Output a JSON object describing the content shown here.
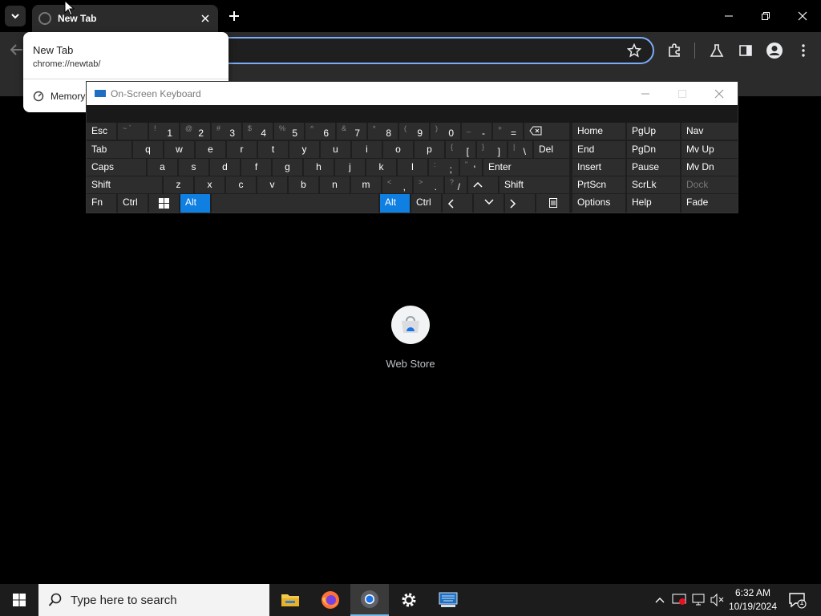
{
  "browser": {
    "tab_title": "New Tab",
    "hovercard": {
      "title": "New Tab",
      "url": "chrome://newtab/",
      "memory_label": "Memory"
    }
  },
  "osk": {
    "title": "On-Screen Keyboard",
    "rows": [
      [
        "Esc",
        "~ `",
        "! 1",
        "@ 2",
        "# 3",
        "$ 4",
        "% 5",
        "^ 6",
        "& 7",
        "* 8",
        "( 9",
        ") 0",
        "_ -",
        "+ =",
        "⌫",
        "Home",
        "PgUp",
        "Nav"
      ],
      [
        "Tab",
        "q",
        "w",
        "e",
        "r",
        "t",
        "y",
        "u",
        "i",
        "o",
        "p",
        "{ [",
        "} ]",
        "| \\",
        "Del",
        "End",
        "PgDn",
        "Mv Up"
      ],
      [
        "Caps",
        "a",
        "s",
        "d",
        "f",
        "g",
        "h",
        "j",
        "k",
        "l",
        ": ;",
        "\" '",
        "Enter",
        "Insert",
        "Pause",
        "Mv Dn"
      ],
      [
        "Shift",
        "z",
        "x",
        "c",
        "v",
        "b",
        "n",
        "m",
        "< ,",
        "> .",
        "? /",
        "^",
        "Shift",
        "PrtScn",
        "ScrLk",
        "Dock"
      ],
      [
        "Fn",
        "Ctrl",
        "Win",
        "Alt",
        "",
        "Alt",
        "Ctrl",
        "<",
        "v",
        ">",
        "Menu",
        "Options",
        "Help",
        "Fade"
      ]
    ],
    "labels": {
      "esc": "Esc",
      "tab": "Tab",
      "caps": "Caps",
      "shift": "Shift",
      "fn": "Fn",
      "ctrl": "Ctrl",
      "alt": "Alt",
      "del": "Del",
      "enter": "Enter",
      "home": "Home",
      "pgup": "PgUp",
      "nav": "Nav",
      "end": "End",
      "pgdn": "PgDn",
      "mvup": "Mv Up",
      "insert": "Insert",
      "pause": "Pause",
      "mvdn": "Mv Dn",
      "prtscn": "PrtScn",
      "scrlk": "ScrLk",
      "dock": "Dock",
      "options": "Options",
      "help": "Help",
      "fade": "Fade"
    },
    "accent_color": "#0f7fe2"
  },
  "ntp": {
    "shortcut_label": "Web Store"
  },
  "taskbar": {
    "search_placeholder": "Type here to search",
    "time": "6:32 AM",
    "date": "10/19/2024",
    "notification_count": "1"
  }
}
